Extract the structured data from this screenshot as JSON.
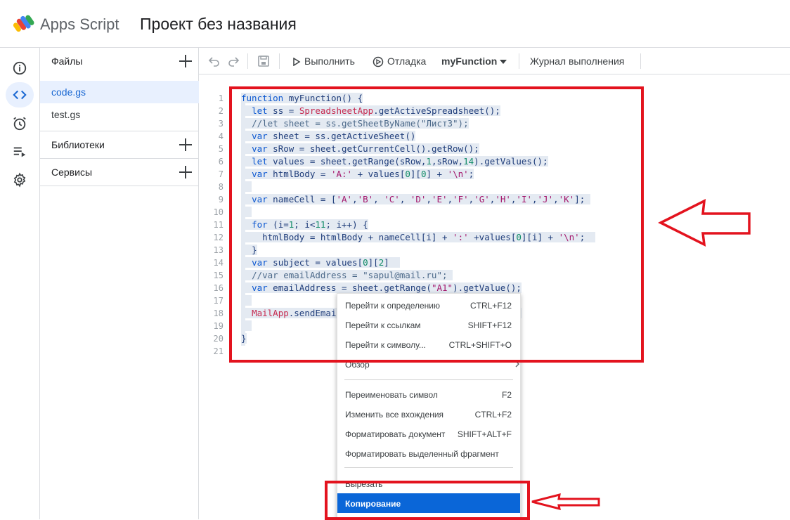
{
  "header": {
    "app_name": "Apps Script",
    "project_title": "Проект без названия"
  },
  "rail": {
    "items": [
      {
        "name": "info-icon",
        "active": false
      },
      {
        "name": "code-icon",
        "active": true
      },
      {
        "name": "alarm-icon",
        "active": false
      },
      {
        "name": "executions-icon",
        "active": false
      },
      {
        "name": "gear-icon",
        "active": false
      }
    ]
  },
  "files_panel": {
    "files_label": "Файлы",
    "files": [
      "code.gs",
      "test.gs"
    ],
    "libraries_label": "Библиотеки",
    "services_label": "Сервисы"
  },
  "toolbar": {
    "run_label": "Выполнить",
    "debug_label": "Отладка",
    "function_select": "myFunction",
    "log_label": "Журнал выполнения"
  },
  "editor": {
    "line_numbers": [
      "1",
      "2",
      "3",
      "4",
      "5",
      "6",
      "7",
      "8",
      "9",
      "10",
      "11",
      "12",
      "13",
      "14",
      "15",
      "16",
      "17",
      "18",
      "19",
      "20",
      "21"
    ]
  },
  "context_menu": {
    "items": [
      {
        "label": "Перейти к определению",
        "shortcut": "CTRL+F12"
      },
      {
        "label": "Перейти к ссылкам",
        "shortcut": "SHIFT+F12"
      },
      {
        "label": "Перейти к символу...",
        "shortcut": "CTRL+SHIFT+O"
      },
      {
        "label": "Обзор",
        "shortcut": ""
      },
      {
        "label": "Переименовать символ",
        "shortcut": "F2"
      },
      {
        "label": "Изменить все вхождения",
        "shortcut": "CTRL+F2"
      },
      {
        "label": "Форматировать документ",
        "shortcut": "SHIFT+ALT+F"
      },
      {
        "label": "Форматировать выделенный фрагмент",
        "shortcut": ""
      },
      {
        "label": "Вырезать",
        "shortcut": ""
      },
      {
        "label": "Копирование",
        "shortcut": ""
      }
    ]
  },
  "colors": {
    "accent": "#1967d2",
    "menu_selected": "#0a66d8",
    "annotation_red": "#e3131e"
  }
}
